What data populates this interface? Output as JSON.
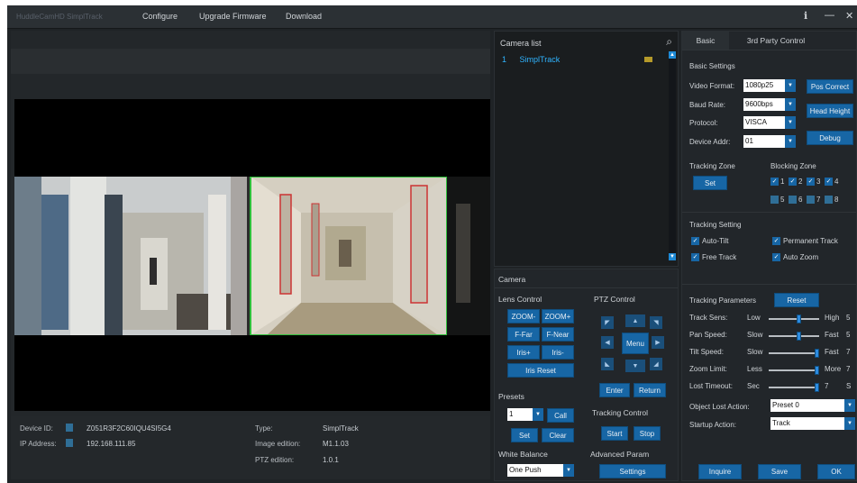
{
  "titlebar": {
    "app_title": "HuddleCamHD SimplTrack",
    "menu": [
      "Configure",
      "Upgrade Firmware",
      "Download"
    ],
    "icons": [
      "info-icon",
      "minimize-icon",
      "close-icon"
    ]
  },
  "info": {
    "device_id_label": "Device ID:",
    "device_id": "Z051R3F2C60IQU4SI5G4",
    "ip_label": "IP Address:",
    "ip": "192.168.111.85",
    "type_label": "Type:",
    "type": "SimplTrack",
    "image_edition_label": "Image edition:",
    "image_edition": "M1.1.03",
    "ptz_edition_label": "PTZ edition:",
    "ptz_edition": "1.0.1"
  },
  "camera_list": {
    "title": "Camera list",
    "items": [
      {
        "index": "1",
        "name": "SimplTrack"
      }
    ]
  },
  "camera": {
    "title": "Camera",
    "lens_control": "Lens Control",
    "lens_buttons": [
      "ZOOM-",
      "ZOOM+",
      "F-Far",
      "F-Near",
      "Iris+",
      "Iris-"
    ],
    "iris_reset": "Iris Reset",
    "ptz_control": "PTZ Control",
    "menu": "Menu",
    "enter": "Enter",
    "return": "Return",
    "presets": "Presets",
    "preset_value": "1",
    "call": "Call",
    "set": "Set",
    "clear": "Clear",
    "tracking_control": "Tracking Control",
    "start": "Start",
    "stop": "Stop",
    "white_balance": "White Balance",
    "wb_value": "One Push",
    "advanced_param": "Advanced Param",
    "settings": "Settings"
  },
  "settings": {
    "tabs": [
      "Basic",
      "3rd Party Control"
    ],
    "basic_settings": "Basic Settings",
    "video_format_label": "Video Format:",
    "video_format": "1080p25",
    "baud_rate_label": "Baud Rate:",
    "baud_rate": "9600bps",
    "protocol_label": "Protocol:",
    "protocol": "VISCA",
    "device_addr_label": "Device Addr:",
    "device_addr": "01",
    "pos_correct": "Pos Correct",
    "head_height": "Head Height",
    "debug": "Debug",
    "tracking_zone": "Tracking Zone",
    "tz_set": "Set",
    "blocking_zone": "Blocking Zone",
    "blocking_checked": [
      "1",
      "2",
      "3",
      "4"
    ],
    "blocking_unchecked": [
      "5",
      "6",
      "7",
      "8"
    ],
    "tracking_setting": "Tracking Setting",
    "auto_tilt": "Auto-Tilt",
    "permanent_track": "Permanent Track",
    "free_track": "Free Track",
    "auto_zoom": "Auto Zoom",
    "tracking_parameters": "Tracking Parameters",
    "reset": "Reset",
    "params": [
      {
        "label": "Track Sens:",
        "low": "Low",
        "high": "High",
        "value": "5",
        "level": 0.6
      },
      {
        "label": "Pan Speed:",
        "low": "Slow",
        "high": "Fast",
        "value": "5",
        "level": 0.6
      },
      {
        "label": "Tilt Speed:",
        "low": "Slow",
        "high": "Fast",
        "value": "7",
        "level": 1.0
      },
      {
        "label": "Zoom Limit:",
        "low": "Less",
        "high": "More",
        "value": "7",
        "level": 1.0
      },
      {
        "label": "Lost Timeout:",
        "low": "Sec",
        "high": "7",
        "value": "S",
        "level": 1.0
      }
    ],
    "object_lost_label": "Object Lost Action:",
    "object_lost": "Preset 0",
    "startup_label": "Startup Action:",
    "startup": "Track",
    "inquire": "Inquire",
    "save": "Save",
    "ok": "OK"
  },
  "colors": {
    "accent": "#1766a5",
    "selection": "#2fb4ff"
  }
}
